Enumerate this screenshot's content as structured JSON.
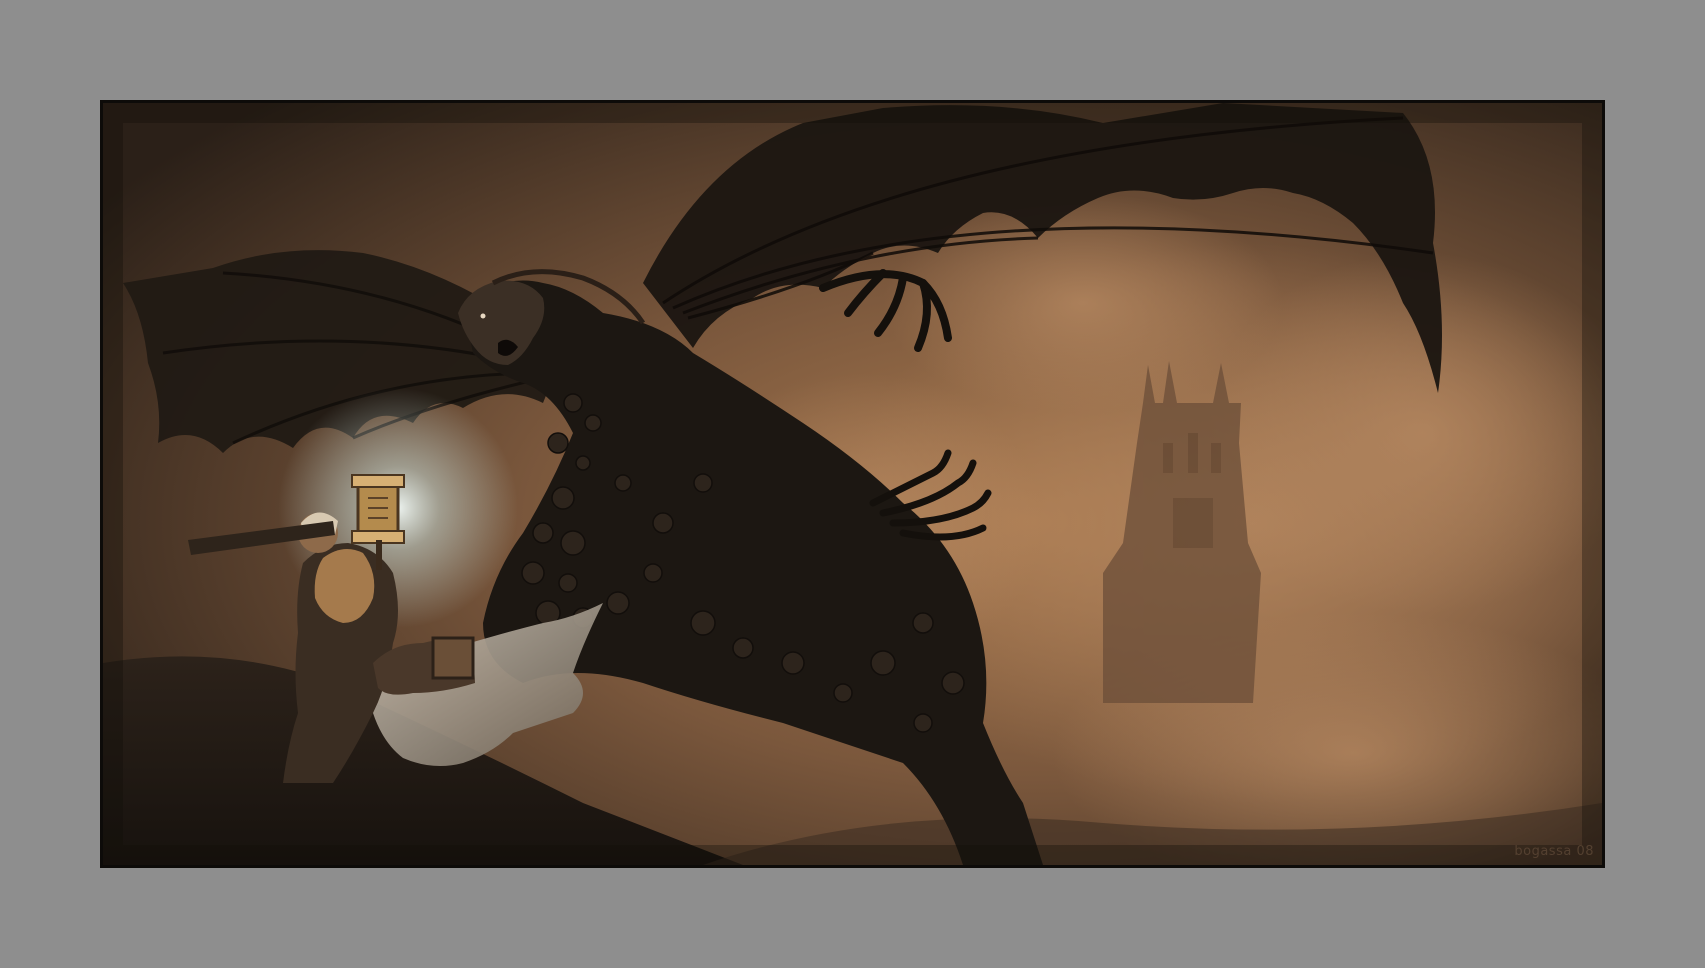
{
  "artwork": {
    "signature": "bogassa 08"
  },
  "colors": {
    "matte": "#8e8e8e",
    "frame_border": "#0d0b09",
    "sky_dark": "#2a1f17",
    "sky_warm": "#a97c56",
    "creature": "#1c1712",
    "glow": "#dfe9e6"
  }
}
